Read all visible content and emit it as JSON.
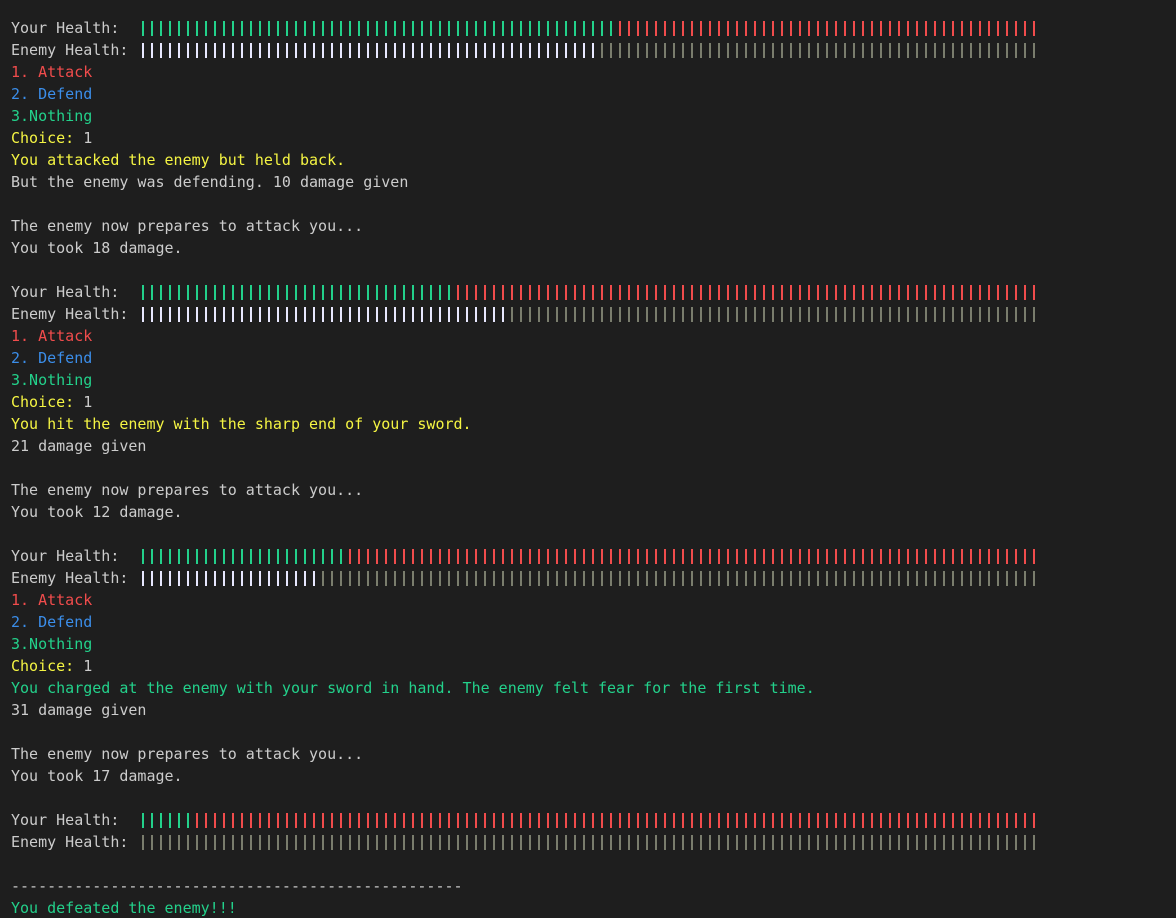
{
  "colors": {
    "background": "#1e1e1e",
    "text": "#cccccc",
    "your_health_filled": "#23d18b",
    "your_health_empty": "#f14c4c",
    "enemy_health_filled": "#e8e8ff",
    "enemy_health_empty": "#7a7d6d",
    "option_attack": "#f14c4c",
    "option_defend": "#3b8eea",
    "option_nothing": "#23d18b",
    "choice_prompt": "#f5f543",
    "action_yellow": "#f5f543",
    "action_green": "#23d18b"
  },
  "bar_total_ticks": 100,
  "labels": {
    "your_health": "Your Health:",
    "enemy_health": "Enemy Health:",
    "attack": "1. Attack",
    "defend": "2. Defend",
    "nothing": "3.Nothing",
    "choice": "Choice:",
    "enemy_prepares": "The enemy now prepares to attack you..."
  },
  "rounds": [
    {
      "your_health_ticks": 53,
      "enemy_health_ticks": 51,
      "choice_value": " 1",
      "action_text": "You attacked the enemy but held back.",
      "action_color": "yellow",
      "result_text": "But the enemy was defending. 10 damage given",
      "damage_taken_text": "You took 18 damage."
    },
    {
      "your_health_ticks": 35,
      "enemy_health_ticks": 41,
      "choice_value": " 1",
      "action_text": "You hit the enemy with the sharp end of your sword.",
      "action_color": "yellow",
      "result_text": "21 damage given",
      "damage_taken_text": "You took 12 damage."
    },
    {
      "your_health_ticks": 23,
      "enemy_health_ticks": 20,
      "choice_value": " 1",
      "action_text": "You charged at the enemy with your sword in hand. The enemy felt fear for the first time.",
      "action_color": "green",
      "result_text": "31 damage given",
      "damage_taken_text": "You took 17 damage."
    }
  ],
  "final": {
    "your_health_ticks": 6,
    "enemy_health_ticks": 0,
    "separator": "--------------------------------------------------",
    "victory_text": "You defeated the enemy!!!"
  }
}
